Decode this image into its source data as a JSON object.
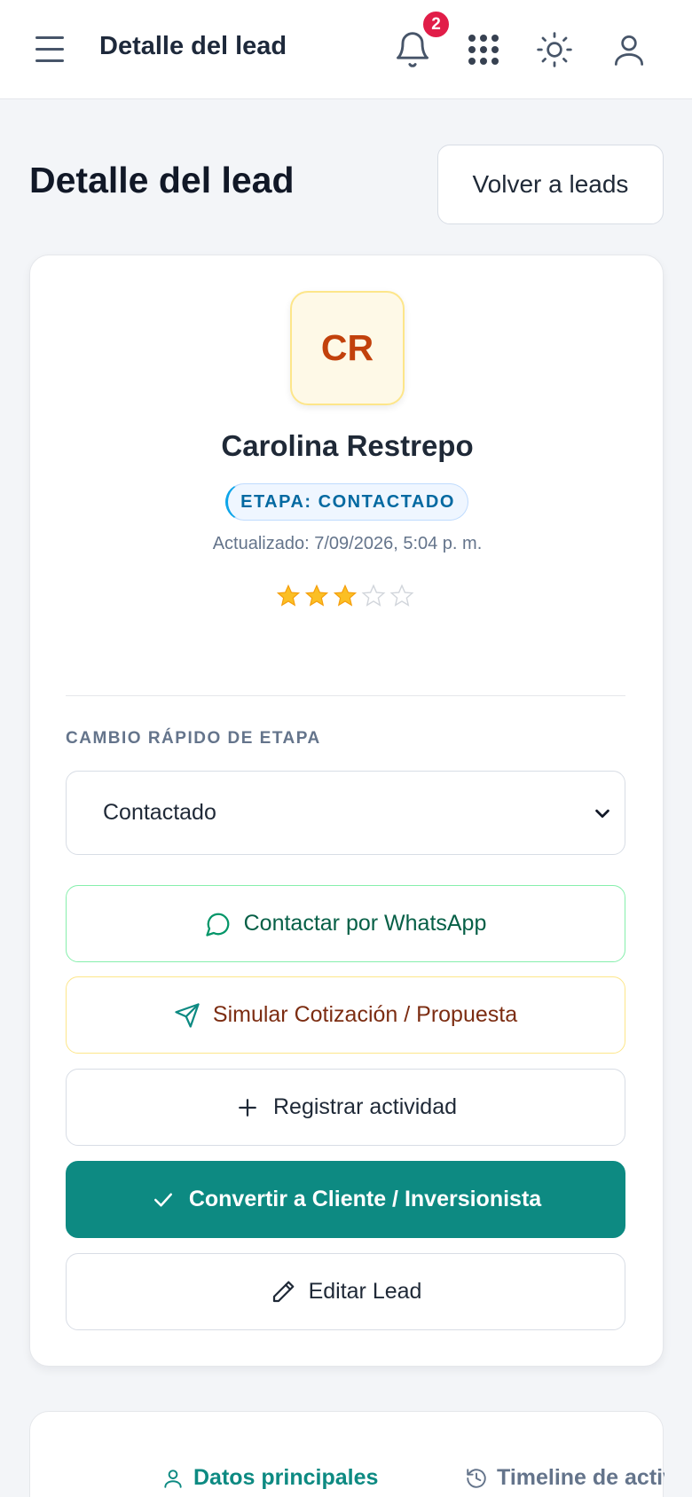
{
  "header": {
    "title": "Detalle del lead",
    "notifications_count": "2",
    "icons": [
      "menu-icon",
      "bell-icon",
      "apps-grid-icon",
      "sun-icon",
      "user-icon"
    ]
  },
  "page": {
    "title": "Detalle del lead",
    "back_label": "Volver a leads"
  },
  "lead": {
    "initials": "CR",
    "name": "Carolina Restrepo",
    "stage_badge": "ETAPA: CONTACTADO",
    "updated": "Actualizado: 7/09/2026, 5:04 p. m.",
    "rating": 3,
    "rating_max": 5
  },
  "quick_stage": {
    "label": "CAMBIO RÁPIDO DE ETAPA",
    "selected": "Contactado"
  },
  "actions": {
    "whatsapp": "Contactar por WhatsApp",
    "simulate": "Simular Cotización / Propuesta",
    "register": "Registrar actividad",
    "convert": "Convertir a Cliente / Inversionista",
    "edit": "Editar Lead"
  },
  "tabs": {
    "main": "Datos principales",
    "timeline": "Timeline de actividad"
  },
  "colors": {
    "accent": "#0d8a82",
    "star": "#fbbf24",
    "badge": "#e11d48"
  }
}
